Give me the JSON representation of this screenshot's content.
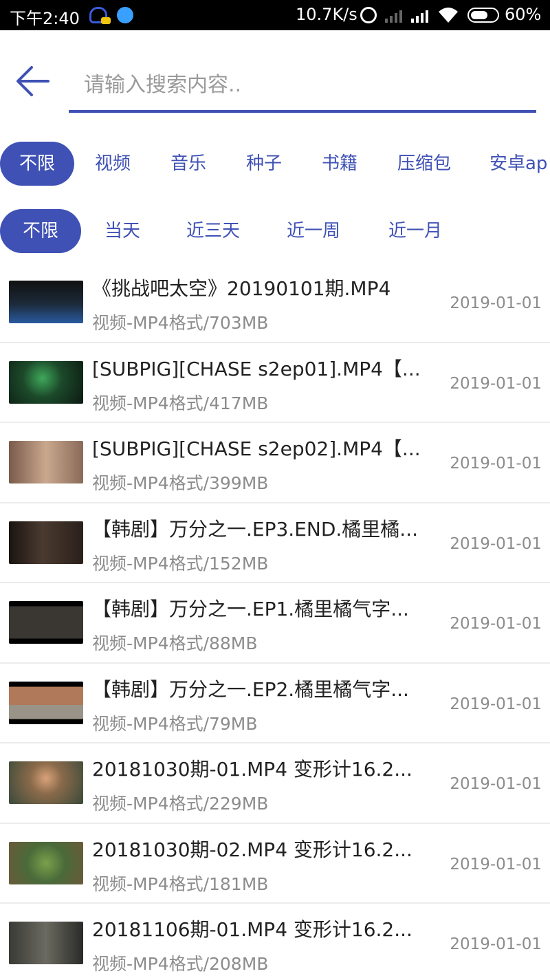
{
  "status_bar": {
    "time": "下午2:40",
    "net_speed": "10.7K/s",
    "battery": "60%"
  },
  "search": {
    "placeholder": "请输入搜索内容..",
    "value": ""
  },
  "type_filters": [
    "不限",
    "视频",
    "音乐",
    "种子",
    "书籍",
    "压缩包",
    "安卓ap"
  ],
  "type_selected": "不限",
  "date_filters": [
    "不限",
    "当天",
    "近三天",
    "近一周",
    "近一月"
  ],
  "date_selected": "不限",
  "colors": {
    "accent": "#3f51b5",
    "meta_text": "#8c8c8c"
  },
  "results": [
    {
      "title": "《挑战吧太空》20190101期.MP4",
      "meta": "视频-MP4格式/703MB",
      "date": "2019-01-01"
    },
    {
      "title": "[SUBPIG][CHASE s2ep01].MP4【...",
      "meta": "视频-MP4格式/417MB",
      "date": "2019-01-01"
    },
    {
      "title": "[SUBPIG][CHASE s2ep02].MP4【...",
      "meta": "视频-MP4格式/399MB",
      "date": "2019-01-01"
    },
    {
      "title": "【韩剧】万分之一.EP3.END.橘里橘...",
      "meta": "视频-MP4格式/152MB",
      "date": "2019-01-01"
    },
    {
      "title": "【韩剧】万分之一.EP1.橘里橘气字...",
      "meta": "视频-MP4格式/88MB",
      "date": "2019-01-01"
    },
    {
      "title": "【韩剧】万分之一.EP2.橘里橘气字...",
      "meta": "视频-MP4格式/79MB",
      "date": "2019-01-01"
    },
    {
      "title": "20181030期-01.MP4 变形计16.2...",
      "meta": "视频-MP4格式/229MB",
      "date": "2019-01-01"
    },
    {
      "title": "20181030期-02.MP4 变形计16.2...",
      "meta": "视频-MP4格式/181MB",
      "date": "2019-01-01"
    },
    {
      "title": "20181106期-01.MP4 变形计16.2...",
      "meta": "视频-MP4格式/208MB",
      "date": "2019-01-01"
    }
  ]
}
